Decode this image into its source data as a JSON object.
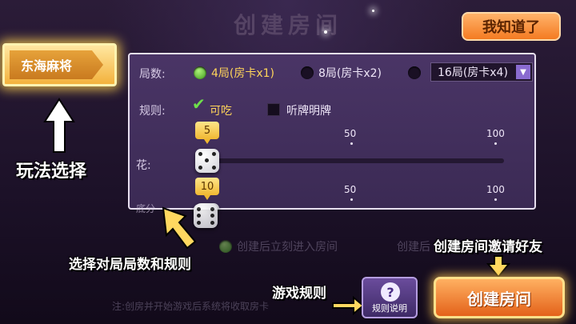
{
  "header": {
    "title": "创建房间"
  },
  "top_button": {
    "label": "我知道了"
  },
  "mode_tab": {
    "label": "东海麻将"
  },
  "annotations": {
    "mode": "玩法选择",
    "rules_panel": "选择对局局数和规则",
    "game_rules": "游戏规则",
    "create_invite": "创建房间邀请好友"
  },
  "panel": {
    "rounds": {
      "label": "局数:",
      "options": [
        "4局(房卡x1)",
        "8局(房卡x2)"
      ],
      "selected": "4局(房卡x1)",
      "dropdown_value": "16局(房卡x4)"
    },
    "rules": {
      "label": "规则:",
      "options": [
        {
          "text": "可吃",
          "checked": true
        },
        {
          "text": "听牌明牌",
          "checked": false
        }
      ]
    },
    "flower": {
      "label": "花:",
      "value": "5",
      "ticks": [
        "50",
        "100"
      ],
      "level": 0.05
    },
    "base": {
      "label": "底分",
      "value": "10",
      "ticks": [
        "50",
        "100"
      ],
      "level": 0.1
    }
  },
  "hidden_row": {
    "option": "创建后立刻进入房间",
    "option_partial": "创建后"
  },
  "bottom": {
    "help_label": "规则说明",
    "help_icon": "?",
    "create_label": "创建房间",
    "notice": "注:创房并开始游戏后系统将收取房卡"
  },
  "colors": {
    "accent_orange": "#f47b22",
    "panel_bg": "#3b2a54",
    "selected_text": "#ffd45a",
    "check_green": "#6ee04a"
  }
}
